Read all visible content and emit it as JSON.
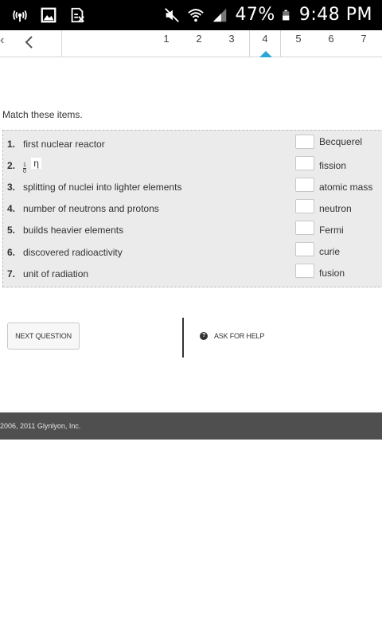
{
  "status_bar": {
    "battery_percent": "47%",
    "time": "9:48 PM",
    "icons": [
      "broadcast-icon",
      "gallery-icon",
      "sim-off-icon",
      "mute-icon",
      "wifi-icon",
      "signal-icon",
      "battery-icon"
    ]
  },
  "question_nav": {
    "back_edge_glyph": "‹",
    "numbers": [
      "1",
      "2",
      "3",
      "4",
      "5",
      "6",
      "7"
    ],
    "active_number": "4",
    "active_color": "#29a7d5"
  },
  "instruction": "Match these items.",
  "items": [
    {
      "num": "1.",
      "text": "first nuclear reactor"
    },
    {
      "num": "2.",
      "text": "",
      "formula": {
        "numerator": "1",
        "denominator": "0",
        "symbol": "η"
      }
    },
    {
      "num": "3.",
      "text": "splitting of nuclei into lighter elements"
    },
    {
      "num": "4.",
      "text": "number of neutrons and protons"
    },
    {
      "num": "5.",
      "text": "builds heavier elements"
    },
    {
      "num": "6.",
      "text": "discovered radioactivity"
    },
    {
      "num": "7.",
      "text": "unit of radiation"
    }
  ],
  "answers": [
    "Becquerel",
    "fission",
    "atomic mass",
    "neutron",
    "Fermi",
    "curie",
    "fusion"
  ],
  "buttons": {
    "next_question": "NEXT QUESTION",
    "ask_for_help": "ASK FOR HELP",
    "help_icon_glyph": "?"
  },
  "footer": {
    "copyright": "2006, 2011 Glynlyon, Inc."
  }
}
